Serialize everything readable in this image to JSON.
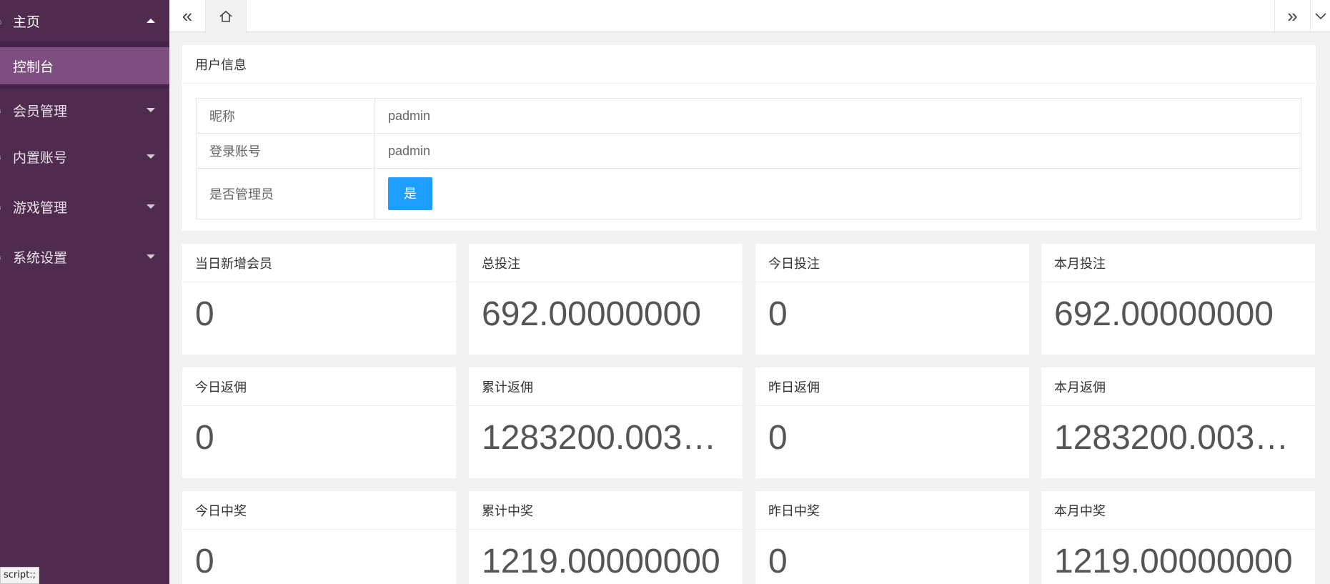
{
  "sidebar": {
    "items": [
      {
        "label": "主页",
        "icon": "home-icon",
        "expanded": true
      },
      {
        "label": "会员管理",
        "icon": "users-icon",
        "expanded": false
      },
      {
        "label": "内置账号",
        "icon": "users-icon",
        "expanded": false
      },
      {
        "label": "游戏管理",
        "icon": "users-icon",
        "expanded": false
      },
      {
        "label": "系统设置",
        "icon": "settings-icon",
        "expanded": false
      }
    ],
    "sub_items": [
      {
        "label": "控制台",
        "active": true
      }
    ]
  },
  "status_tip": "script:;",
  "topbar": {
    "left_icon": "double-chevron-left-icon",
    "home_icon": "home-icon",
    "right_icon": "double-chevron-right-icon",
    "menu_icon": "chevron-down-icon"
  },
  "user_info": {
    "title": "用户信息",
    "rows": [
      {
        "label": "昵称",
        "value": "padmin"
      },
      {
        "label": "登录账号",
        "value": "padmin"
      },
      {
        "label": "是否管理员",
        "value": "是"
      }
    ]
  },
  "stats": [
    {
      "label": "当日新增会员",
      "value": "0"
    },
    {
      "label": "总投注",
      "value": "692.00000000"
    },
    {
      "label": "今日投注",
      "value": "0"
    },
    {
      "label": "本月投注",
      "value": "692.00000000"
    },
    {
      "label": "今日返佣",
      "value": "0"
    },
    {
      "label": "累计返佣",
      "value": "1283200.0032…"
    },
    {
      "label": "昨日返佣",
      "value": "0"
    },
    {
      "label": "本月返佣",
      "value": "1283200.0032…"
    },
    {
      "label": "今日中奖",
      "value": "0"
    },
    {
      "label": "累计中奖",
      "value": "1219.00000000"
    },
    {
      "label": "昨日中奖",
      "value": "0"
    },
    {
      "label": "本月中奖",
      "value": "1219.00000000"
    }
  ],
  "colors": {
    "sidebar_bg": "#4f2c4f",
    "active_item_bg": "#7d4f80",
    "admin_button": "#1e9fff"
  }
}
